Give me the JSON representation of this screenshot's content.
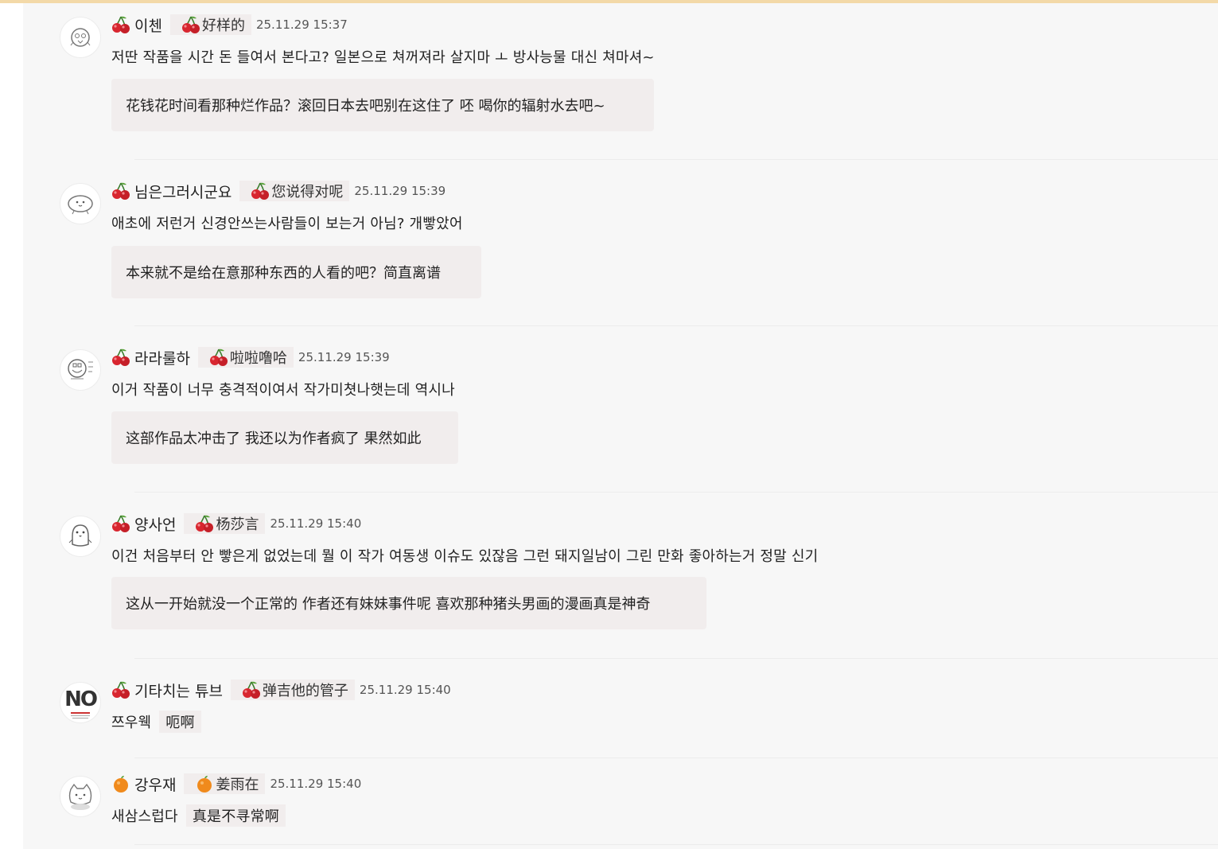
{
  "comments": [
    {
      "author": "이첸",
      "author_translated": "好样的",
      "icon": "cherry-icon",
      "avatar": "bird-avatar",
      "timestamp": "25.11.29 15:37",
      "text": "저딴 작품을 시간 돈 들여서 본다고? 일본으로 쳐꺼져라 살지마 ㅗ 방사능물 대신 쳐마셔~",
      "translation": "花钱花时间看那种烂作品？滚回日本去吧别在这住了 呸 喝你的辐射水去吧~"
    },
    {
      "author": "님은그러시군요",
      "author_translated": "您说得对呢",
      "icon": "cherry-icon",
      "avatar": "blob-avatar",
      "timestamp": "25.11.29 15:39",
      "text": "애초에 저런거 신경안쓰는사람들이 보는거 아님? 개빻았어",
      "translation": "本来就不是给在意那种东西的人看的吧？简直离谱"
    },
    {
      "author": "라라룰하",
      "author_translated": "啦啦噜哈",
      "icon": "cherry-icon",
      "avatar": "doodle-avatar",
      "timestamp": "25.11.29 15:39",
      "text": "이거 작품이 너무 충격적이여서 작가미쳣나햇는데 역시나",
      "translation": "这部作品太冲击了 我还以为作者疯了 果然如此"
    },
    {
      "author": "양사언",
      "author_translated": "杨莎言",
      "icon": "cherry-icon",
      "avatar": "penguin-avatar",
      "timestamp": "25.11.29 15:40",
      "text": "이건 처음부터 안 빻은게 없었는데 뭘 이 작가 여동생 이슈도 있잖음 그런 돼지일남이 그린 만화 좋아하는거 정말 신기",
      "translation": "这从一开始就没一个正常的 作者还有妹妹事件呢 喜欢那种猪头男画的漫画真是神奇"
    },
    {
      "author": "기타치는 튜브",
      "author_translated": "弹吉他的管子",
      "icon": "cherry-icon",
      "avatar": "no-logo-avatar",
      "avatar_text": "NO",
      "timestamp": "25.11.29 15:40",
      "text": "쯔우웩",
      "translation": "呃啊"
    },
    {
      "author": "강우재",
      "author_translated": "姜雨在",
      "icon": "orange-icon",
      "avatar": "cat-avatar",
      "timestamp": "25.11.29 15:40",
      "text": "새삼스럽다",
      "translation": "真是不寻常啊"
    }
  ]
}
